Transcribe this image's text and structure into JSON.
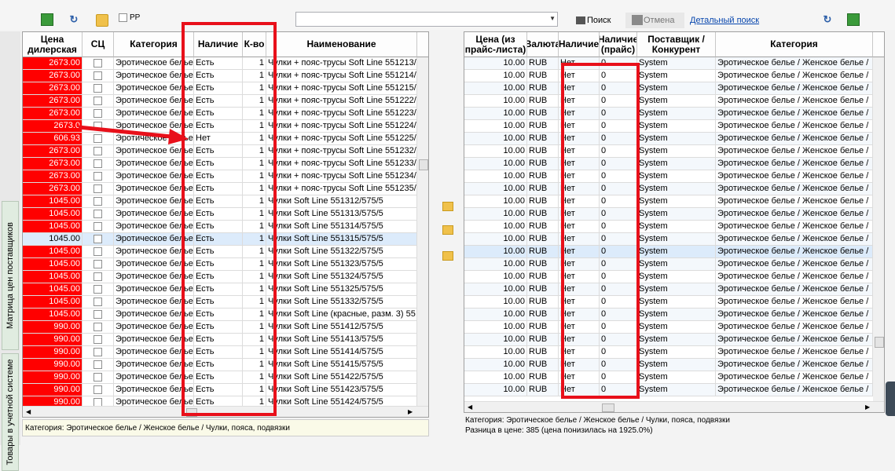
{
  "toolbar": {
    "pp_label": "РР",
    "search_value": "",
    "search_label": "Поиск",
    "cancel_label": "Отмена",
    "detailed_search_label": "Детальный поиск"
  },
  "side_tabs": {
    "price_matrix": "Матрица цен поставщиков",
    "accounting_goods": "Товары в учетной системе"
  },
  "left_grid": {
    "columns": [
      "Цена дилерская",
      "СЦ",
      "Категория",
      "Наличие",
      "К-во",
      "Наименование"
    ],
    "rows": [
      {
        "price": "2673.00",
        "cat": "Эротическое белье",
        "avail": "Есть",
        "qty": "1",
        "name": "Чулки + пояс-трусы Soft Line 551213/"
      },
      {
        "price": "2673.00",
        "cat": "Эротическое белье",
        "avail": "Есть",
        "qty": "1",
        "name": "Чулки + пояс-трусы Soft Line 551214/"
      },
      {
        "price": "2673.00",
        "cat": "Эротическое белье",
        "avail": "Есть",
        "qty": "1",
        "name": "Чулки + пояс-трусы Soft Line 551215/"
      },
      {
        "price": "2673.00",
        "cat": "Эротическое белье",
        "avail": "Есть",
        "qty": "1",
        "name": "Чулки + пояс-трусы Soft Line 551222/"
      },
      {
        "price": "2673.00",
        "cat": "Эротическое белье",
        "avail": "Есть",
        "qty": "1",
        "name": "Чулки + пояс-трусы Soft Line 551223/"
      },
      {
        "price": "2673.0",
        "cat": "Эротическое белье",
        "avail": "Есть",
        "qty": "1",
        "name": "Чулки + пояс-трусы Soft Line 551224/"
      },
      {
        "price": "606.93",
        "cat": "Эротическое белье",
        "avail": "Нет",
        "qty": "1",
        "name": "Чулки + пояс-трусы Soft Line 551225/"
      },
      {
        "price": "2673.00",
        "cat": "Эротическое белье",
        "avail": "Есть",
        "qty": "1",
        "name": "Чулки + пояс-трусы Soft Line 551232/"
      },
      {
        "price": "2673.00",
        "cat": "Эротическое белье",
        "avail": "Есть",
        "qty": "1",
        "name": "Чулки + пояс-трусы Soft Line 551233/"
      },
      {
        "price": "2673.00",
        "cat": "Эротическое белье",
        "avail": "Есть",
        "qty": "1",
        "name": "Чулки + пояс-трусы Soft Line 551234/"
      },
      {
        "price": "2673.00",
        "cat": "Эротическое белье",
        "avail": "Есть",
        "qty": "1",
        "name": "Чулки + пояс-трусы Soft Line 551235/"
      },
      {
        "price": "1045.00",
        "cat": "Эротическое белье",
        "avail": "Есть",
        "qty": "1",
        "name": "Чулки Soft Line 551312/575/5"
      },
      {
        "price": "1045.00",
        "cat": "Эротическое белье",
        "avail": "Есть",
        "qty": "1",
        "name": "Чулки Soft Line 551313/575/5"
      },
      {
        "price": "1045.00",
        "cat": "Эротическое белье",
        "avail": "Есть",
        "qty": "1",
        "name": "Чулки Soft Line 551314/575/5"
      },
      {
        "price": "1045.00",
        "cat": "Эротическое белье",
        "avail": "Есть",
        "qty": "1",
        "name": "Чулки Soft Line 551315/575/5"
      },
      {
        "price": "1045.00",
        "cat": "Эротическое белье",
        "avail": "Есть",
        "qty": "1",
        "name": "Чулки Soft Line 551322/575/5"
      },
      {
        "price": "1045.00",
        "cat": "Эротическое белье",
        "avail": "Есть",
        "qty": "1",
        "name": "Чулки Soft Line 551323/575/5"
      },
      {
        "price": "1045.00",
        "cat": "Эротическое белье",
        "avail": "Есть",
        "qty": "1",
        "name": "Чулки Soft Line 551324/575/5"
      },
      {
        "price": "1045.00",
        "cat": "Эротическое белье",
        "avail": "Есть",
        "qty": "1",
        "name": "Чулки  Soft Line 551325/575/5"
      },
      {
        "price": "1045.00",
        "cat": "Эротическое белье",
        "avail": "Есть",
        "qty": "1",
        "name": "Чулки Soft Line 551332/575/5"
      },
      {
        "price": "1045.00",
        "cat": "Эротическое белье",
        "avail": "Есть",
        "qty": "1",
        "name": "Чулки Soft Line (красные, разм. 3) 55"
      },
      {
        "price": "990.00",
        "cat": "Эротическое белье",
        "avail": "Есть",
        "qty": "1",
        "name": "Чулки Soft Line 551412/575/5"
      },
      {
        "price": "990.00",
        "cat": "Эротическое белье",
        "avail": "Есть",
        "qty": "1",
        "name": "Чулки Soft Line 551413/575/5"
      },
      {
        "price": "990.00",
        "cat": "Эротическое белье",
        "avail": "Есть",
        "qty": "1",
        "name": "Чулки Soft Line 551414/575/5"
      },
      {
        "price": "990.00",
        "cat": "Эротическое белье",
        "avail": "Есть",
        "qty": "1",
        "name": "Чулки Soft Line 551415/575/5"
      },
      {
        "price": "990.00",
        "cat": "Эротическое белье",
        "avail": "Есть",
        "qty": "1",
        "name": "Чулки Soft Line 551422/575/5"
      },
      {
        "price": "990.00",
        "cat": "Эротическое белье",
        "avail": "Есть",
        "qty": "1",
        "name": "Чулки Soft Line 551423/575/5"
      },
      {
        "price": "990.00",
        "cat": "Эротическое белье",
        "avail": "Есть",
        "qty": "1",
        "name": "Чулки Soft Line 551424/575/5"
      }
    ],
    "status": "Категория: Эротическое белье / Женское белье / Чулки, пояса, подвязки"
  },
  "right_grid": {
    "columns": [
      "Цена (из прайс-листа)",
      "Валюта",
      "Наличие",
      "Наличие (прайс)",
      "Поставщик / Конкурент",
      "Категория"
    ],
    "row": {
      "price": "10.00",
      "currency": "RUB",
      "avail": "Нет",
      "qty": "0",
      "supplier": "System",
      "cat": "Эротическое белье / Женское белье /"
    },
    "row_count": 27,
    "status_category": "Категория: Эротическое белье / Женское белье / Чулки, пояса, подвязки",
    "status_diff": "Разница в цене: 385  (цена понизилась на 1925.0%)"
  },
  "colors": {
    "highlight_red": "#ff0000",
    "annotation_red": "#e8101a",
    "selected_row": "#dcebfb"
  }
}
